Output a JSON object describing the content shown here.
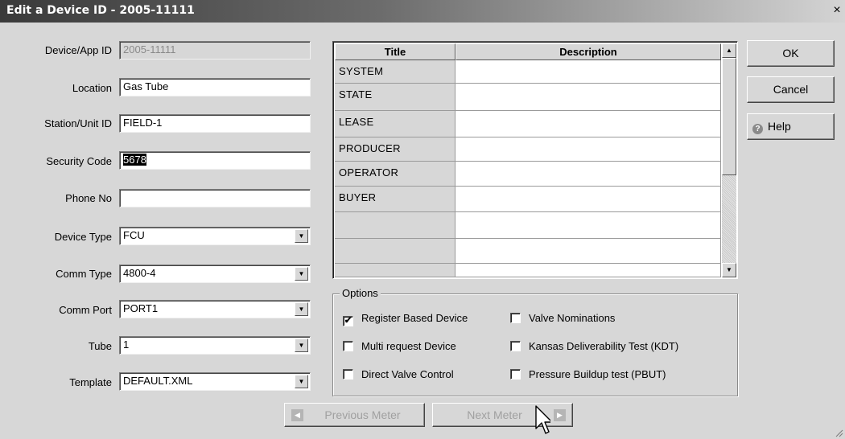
{
  "window": {
    "title": "Edit a Device ID - 2005-11111",
    "close_glyph": "×"
  },
  "form": {
    "device_app_id": {
      "label": "Device/App ID",
      "value": "2005-11111"
    },
    "location": {
      "label": "Location",
      "value": "Gas Tube"
    },
    "station_unit_id": {
      "label": "Station/Unit ID",
      "value": "FIELD-1"
    },
    "security_code": {
      "label": "Security Code",
      "value": "5678"
    },
    "phone_no": {
      "label": "Phone No",
      "value": ""
    },
    "device_type": {
      "label": "Device Type",
      "value": "FCU"
    },
    "comm_type": {
      "label": "Comm Type",
      "value": "4800-4"
    },
    "comm_port": {
      "label": "Comm Port",
      "value": "PORT1"
    },
    "tube": {
      "label": "Tube",
      "value": "1"
    },
    "template": {
      "label": "Template",
      "value": "DEFAULT.XML"
    }
  },
  "grid": {
    "headers": {
      "title": "Title",
      "description": "Description"
    },
    "rows": [
      {
        "title": "SYSTEM",
        "description": ""
      },
      {
        "title": "STATE",
        "description": ""
      },
      {
        "title": "LEASE",
        "description": ""
      },
      {
        "title": "PRODUCER",
        "description": ""
      },
      {
        "title": "OPERATOR",
        "description": ""
      },
      {
        "title": "BUYER",
        "description": ""
      },
      {
        "title": "",
        "description": ""
      },
      {
        "title": "",
        "description": ""
      },
      {
        "title": "",
        "description": ""
      }
    ]
  },
  "options": {
    "legend": "Options",
    "register_based_device": {
      "label": "Register Based Device",
      "checked": true
    },
    "valve_nominations": {
      "label": "Valve Nominations",
      "checked": false
    },
    "multi_request_device": {
      "label": "Multi request Device",
      "checked": false
    },
    "kansas_deliverability_test": {
      "label": "Kansas Deliverability Test (KDT)",
      "checked": false
    },
    "direct_valve_control": {
      "label": "Direct Valve Control",
      "checked": false
    },
    "pressure_buildup_test": {
      "label": "Pressure Buildup test (PBUT)",
      "checked": false
    }
  },
  "buttons": {
    "ok": "OK",
    "cancel": "Cancel",
    "help": "Help",
    "previous_meter": "Previous Meter",
    "next_meter": "Next Meter"
  },
  "icons": {
    "dropdown": "chevron-down-icon",
    "help": "help-icon",
    "prev": "arrow-left-icon",
    "next": "arrow-right-icon"
  }
}
